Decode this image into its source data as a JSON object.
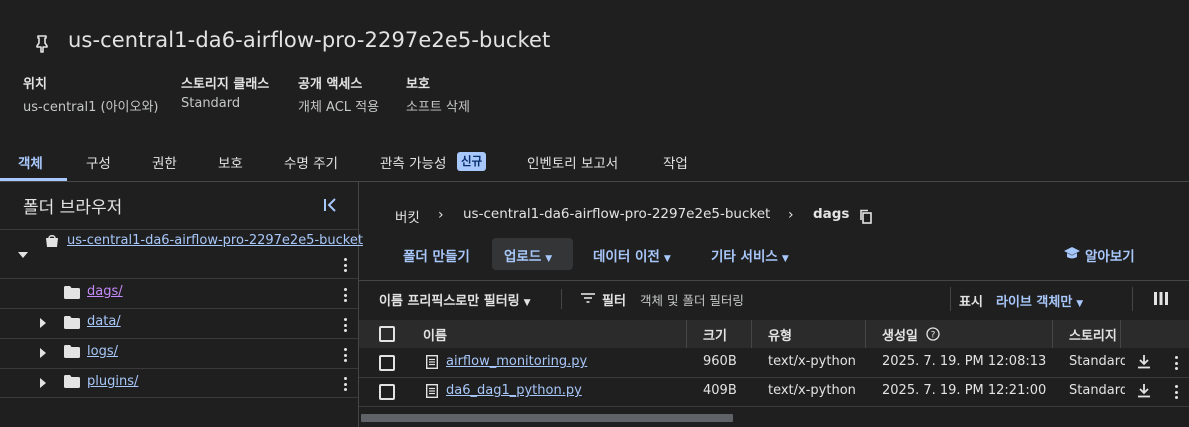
{
  "bucket": {
    "title": "us-central1-da6-airflow-pro-2297e2e5-bucket",
    "pin_icon": "pin-icon"
  },
  "meta": [
    {
      "label": "위치",
      "value": "us-central1 (아이오와)"
    },
    {
      "label": "스토리지 클래스",
      "value": "Standard"
    },
    {
      "label": "공개 액세스",
      "value": "개체 ACL 적용"
    },
    {
      "label": "보호",
      "value": "소프트 삭제"
    }
  ],
  "tabs": [
    {
      "label": "객체",
      "active": true
    },
    {
      "label": "구성"
    },
    {
      "label": "권한"
    },
    {
      "label": "보호"
    },
    {
      "label": "수명 주기"
    },
    {
      "label": "관측 가능성",
      "badge": "신규"
    },
    {
      "label": "인벤토리 보고서"
    },
    {
      "label": "작업"
    }
  ],
  "folder_browser": {
    "title": "폴더 브라우저",
    "root": "us-central1-da6-airflow-pro-2297e2e5-bucket",
    "folders": [
      "dags/",
      "data/",
      "logs/",
      "plugins/"
    ]
  },
  "breadcrumb": {
    "items": [
      "버킷",
      "us-central1-da6-airflow-pro-2297e2e5-bucket",
      "dags"
    ]
  },
  "actions": {
    "create_folder": "폴더 만들기",
    "upload": "업로드",
    "transfer": "데이터 이전",
    "other": "기타 서비스",
    "learn": "알아보기"
  },
  "filter": {
    "prefix_label": "이름 프리픽스로만 필터링",
    "filter_label": "필터",
    "placeholder": "객체 및 폴더 필터링",
    "display_label": "표시",
    "display_value": "라이브 객체만"
  },
  "table": {
    "columns": [
      "이름",
      "크기",
      "유형",
      "생성일",
      "스토리지"
    ],
    "rows": [
      {
        "name": "airflow_monitoring.py",
        "size": "960B",
        "type": "text/x-python",
        "created": "2025. 7. 19. PM 12:08:13",
        "storage": "Standard"
      },
      {
        "name": "da6_dag1_python.py",
        "size": "409B",
        "type": "text/x-python",
        "created": "2025. 7. 19. PM 12:21:00",
        "storage": "Standard"
      }
    ]
  },
  "colors": {
    "background": "#1f1f1f",
    "accent": "#a8c7fa",
    "visited_link": "#c58af9",
    "text": "#e3e3e3"
  }
}
